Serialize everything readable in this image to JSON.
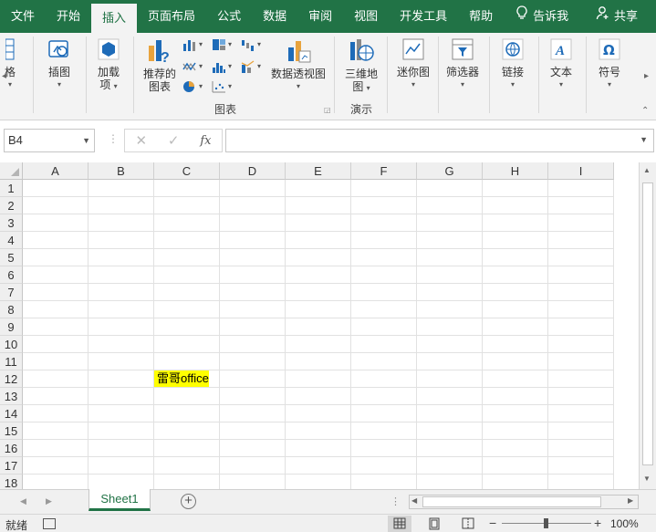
{
  "tabs": [
    "文件",
    "开始",
    "插入",
    "页面布局",
    "公式",
    "数据",
    "审阅",
    "视图",
    "开发工具",
    "帮助"
  ],
  "active_tab": "插入",
  "tell_me": "告诉我",
  "share": "共享",
  "ribbon": {
    "partial_item": "格",
    "illustrations": "插图",
    "addins": "加载\n项",
    "addins_l1": "加载",
    "addins_l2": "项",
    "recommended_l1": "推荐的",
    "recommended_l2": "图表",
    "pivot_chart": "数据透视图",
    "charts_group": "图表",
    "map3d_l1": "三维地",
    "map3d_l2": "图",
    "tours_group": "演示",
    "sparklines": "迷你图",
    "filters": "筛选器",
    "links": "链接",
    "text": "文本",
    "symbols": "符号"
  },
  "formula_bar": {
    "name_box": "B4",
    "fx": "fx",
    "formula": ""
  },
  "columns": [
    "A",
    "B",
    "C",
    "D",
    "E",
    "F",
    "G",
    "H",
    "I"
  ],
  "rows": [
    "1",
    "2",
    "3",
    "4",
    "5",
    "6",
    "7",
    "8",
    "9",
    "10",
    "11",
    "12",
    "13",
    "14",
    "15",
    "16",
    "17",
    "18"
  ],
  "cell_C12": "雷哥office",
  "cell_C12_fill": "#ffff00",
  "sheet_tab": "Sheet1",
  "status": "就绪",
  "zoom": "100%",
  "accent_color": "#217346"
}
